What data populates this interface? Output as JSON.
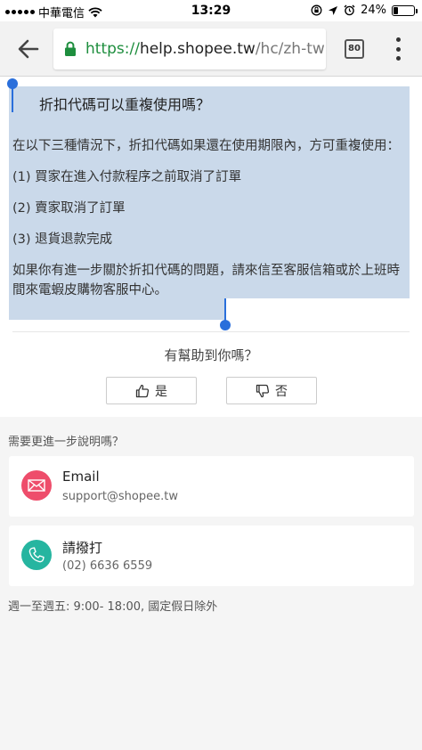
{
  "status_bar": {
    "carrier": "中華電信",
    "time": "13:29",
    "battery": "24%",
    "battery_level": 0.24
  },
  "browser": {
    "url_scheme": "https://",
    "url_host": "help.shopee.tw",
    "url_path": "/hc/zh-tw",
    "tab_count": "80"
  },
  "article": {
    "title": "折扣代碼可以重複使用嗎？",
    "paragraphs": [
      "在以下三種情況下，折扣代碼如果還在使用期限內，方可重複使用：",
      "(1) 買家在進入付款程序之前取消了訂單",
      "(2) 賣家取消了訂單",
      "(3) 退貨退款完成",
      "如果你有進一步關於折扣代碼的問題，請來信至客服信箱或於上班時間來電蝦皮購物客服中心。"
    ]
  },
  "feedback": {
    "question": "有幫助到你嗎？",
    "yes_label": "是",
    "no_label": "否"
  },
  "contact": {
    "heading": "需要更進一步說明嗎？",
    "email": {
      "title": "Email",
      "value": "support@shopee.tw",
      "color": "#ee4d6b"
    },
    "phone": {
      "title": "請撥打",
      "value": "(02) 6636 6559",
      "color": "#26b5a0"
    },
    "hours": "週一至週五: 9:00- 18:00, 國定假日除外"
  },
  "colors": {
    "selection": "#cad9ea",
    "handle": "#2a6fdb",
    "secure": "#1e8e3e"
  }
}
